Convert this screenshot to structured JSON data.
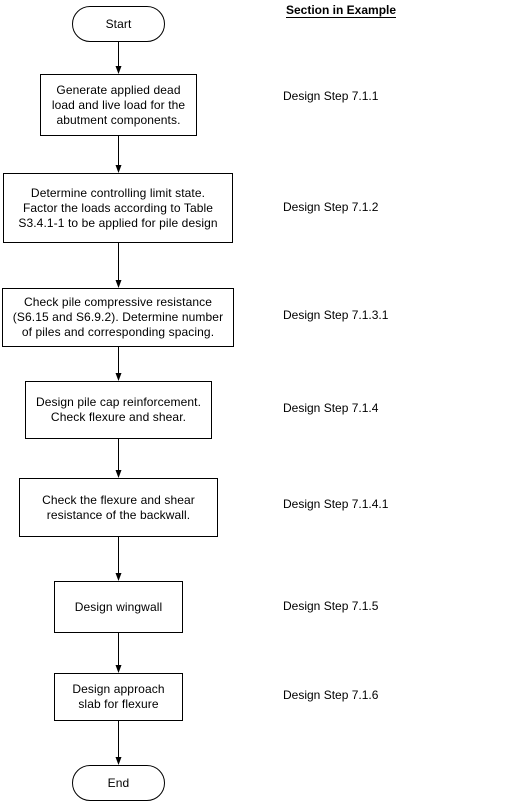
{
  "diagram": {
    "type": "flowchart",
    "column_heading": "Section in Example",
    "nodes": [
      {
        "id": "start",
        "shape": "terminal",
        "text": "Start",
        "section": ""
      },
      {
        "id": "step1",
        "shape": "process",
        "text": "Generate applied dead\nload and live load for the\nabutment components.",
        "section": "Design Step 7.1.1"
      },
      {
        "id": "step2",
        "shape": "process",
        "text": "Determine controlling limit state.\nFactor the loads according to Table\nS3.4.1-1 to be applied for pile design",
        "section": "Design Step 7.1.2"
      },
      {
        "id": "step3",
        "shape": "process",
        "text": "Check pile compressive resistance\n(S6.15 and S6.9.2).  Determine number\nof piles and corresponding spacing.",
        "section": "Design Step 7.1.3.1"
      },
      {
        "id": "step4",
        "shape": "process",
        "text": "Design pile cap reinforcement.\nCheck flexure and shear.",
        "section": "Design Step 7.1.4"
      },
      {
        "id": "step5",
        "shape": "process",
        "text": "Check the flexure and shear\nresistance of the backwall.",
        "section": "Design Step 7.1.4.1"
      },
      {
        "id": "step6",
        "shape": "process",
        "text": "Design wingwall",
        "section": "Design Step 7.1.5"
      },
      {
        "id": "step7",
        "shape": "process",
        "text": "Design approach\nslab for flexure",
        "section": "Design Step 7.1.6"
      },
      {
        "id": "end",
        "shape": "terminal",
        "text": "End",
        "section": ""
      }
    ],
    "edges": [
      {
        "from": "start",
        "to": "step1"
      },
      {
        "from": "step1",
        "to": "step2"
      },
      {
        "from": "step2",
        "to": "step3"
      },
      {
        "from": "step3",
        "to": "step4"
      },
      {
        "from": "step4",
        "to": "step5"
      },
      {
        "from": "step5",
        "to": "step6"
      },
      {
        "from": "step6",
        "to": "step7"
      },
      {
        "from": "step7",
        "to": "end"
      }
    ],
    "colors": {
      "stroke": "#000000",
      "fill": "#ffffff",
      "text": "#000000"
    }
  }
}
